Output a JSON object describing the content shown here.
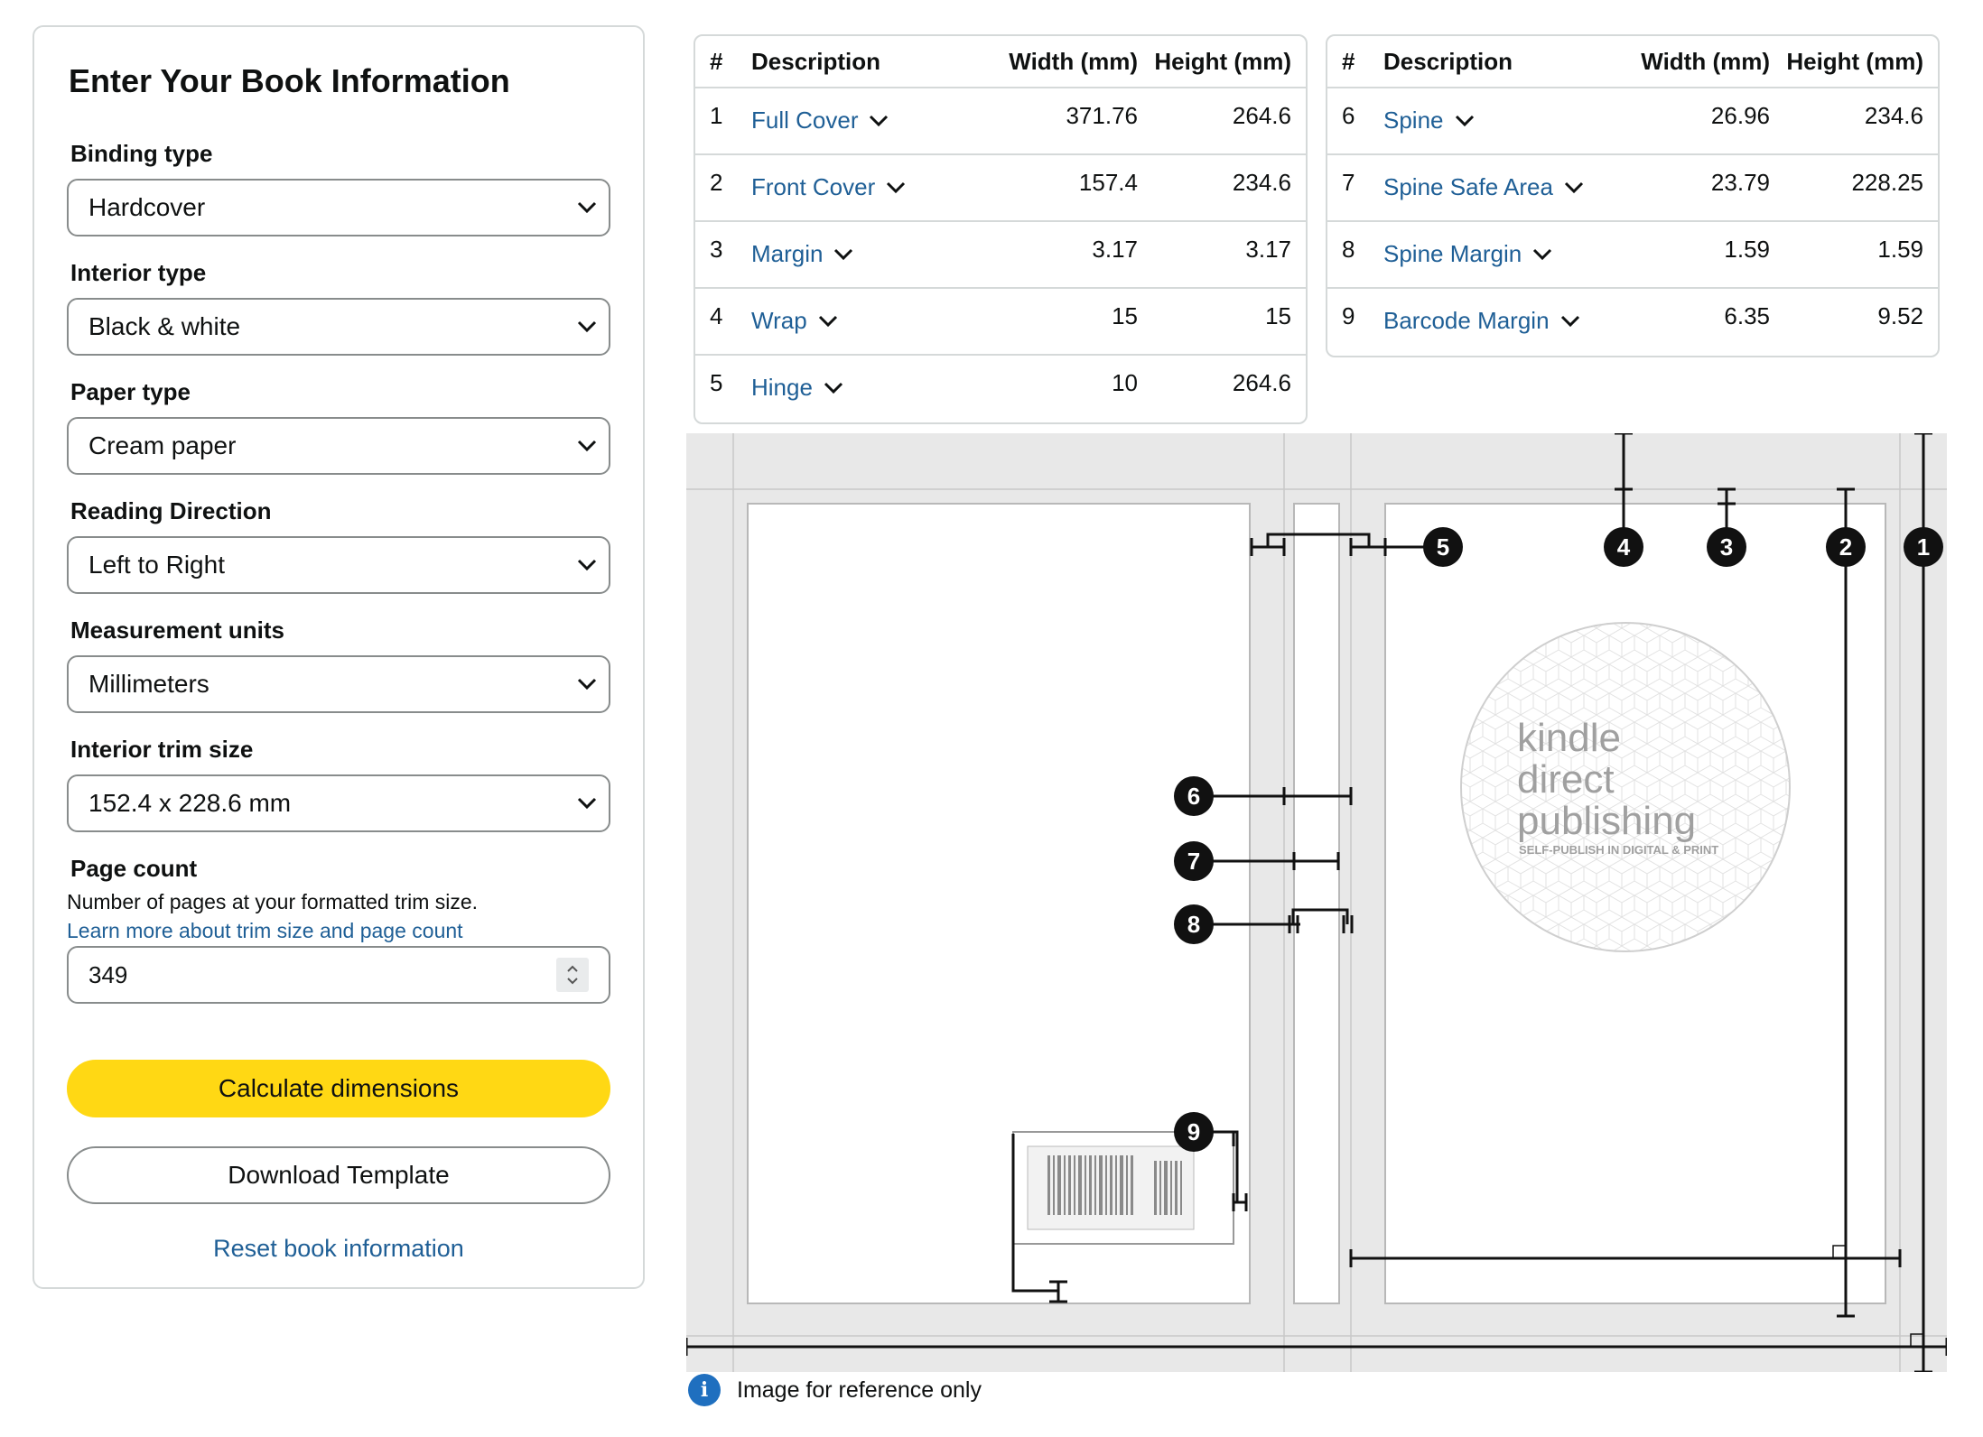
{
  "form": {
    "title": "Enter Your Book Information",
    "fields": {
      "binding": {
        "label": "Binding type",
        "value": "Hardcover"
      },
      "interior": {
        "label": "Interior type",
        "value": "Black & white"
      },
      "paper": {
        "label": "Paper type",
        "value": "Cream paper"
      },
      "direction": {
        "label": "Reading Direction",
        "value": "Left to Right"
      },
      "units": {
        "label": "Measurement units",
        "value": "Millimeters"
      },
      "trim": {
        "label": "Interior trim size",
        "value": "152.4 x 228.6 mm"
      },
      "pages": {
        "label": "Page count",
        "hint": "Number of pages at your formatted trim size.",
        "link": "Learn more about trim size and page count",
        "value": "349"
      }
    },
    "calculate_label": "Calculate dimensions",
    "download_label": "Download Template",
    "reset_label": "Reset book information"
  },
  "table_headers": {
    "num": "#",
    "desc": "Description",
    "width": "Width (mm)",
    "height": "Height (mm)"
  },
  "table_left": [
    {
      "num": "1",
      "desc": "Full Cover",
      "width": "371.76",
      "height": "264.6"
    },
    {
      "num": "2",
      "desc": "Front Cover",
      "width": "157.4",
      "height": "234.6"
    },
    {
      "num": "3",
      "desc": "Margin",
      "width": "3.17",
      "height": "3.17"
    },
    {
      "num": "4",
      "desc": "Wrap",
      "width": "15",
      "height": "15"
    },
    {
      "num": "5",
      "desc": "Hinge",
      "width": "10",
      "height": "264.6"
    }
  ],
  "table_right": [
    {
      "num": "6",
      "desc": "Spine",
      "width": "26.96",
      "height": "234.6"
    },
    {
      "num": "7",
      "desc": "Spine Safe Area",
      "width": "23.79",
      "height": "228.25"
    },
    {
      "num": "8",
      "desc": "Spine Margin",
      "width": "1.59",
      "height": "1.59"
    },
    {
      "num": "9",
      "desc": "Barcode Margin",
      "width": "6.35",
      "height": "9.52"
    }
  ],
  "diagram": {
    "callouts": [
      "1",
      "2",
      "3",
      "4",
      "5",
      "6",
      "7",
      "8",
      "9"
    ],
    "logo": {
      "line1": "kindle",
      "line2": "direct",
      "line3": "publishing",
      "tagline": "SELF-PUBLISH IN DIGITAL & PRINT"
    }
  },
  "note": "Image for reference only",
  "colors": {
    "accent_yellow": "#ffd814",
    "link_blue": "#1f5f96",
    "info_blue": "#1f6fbf",
    "diagram_gray": "#e8e8e8"
  }
}
